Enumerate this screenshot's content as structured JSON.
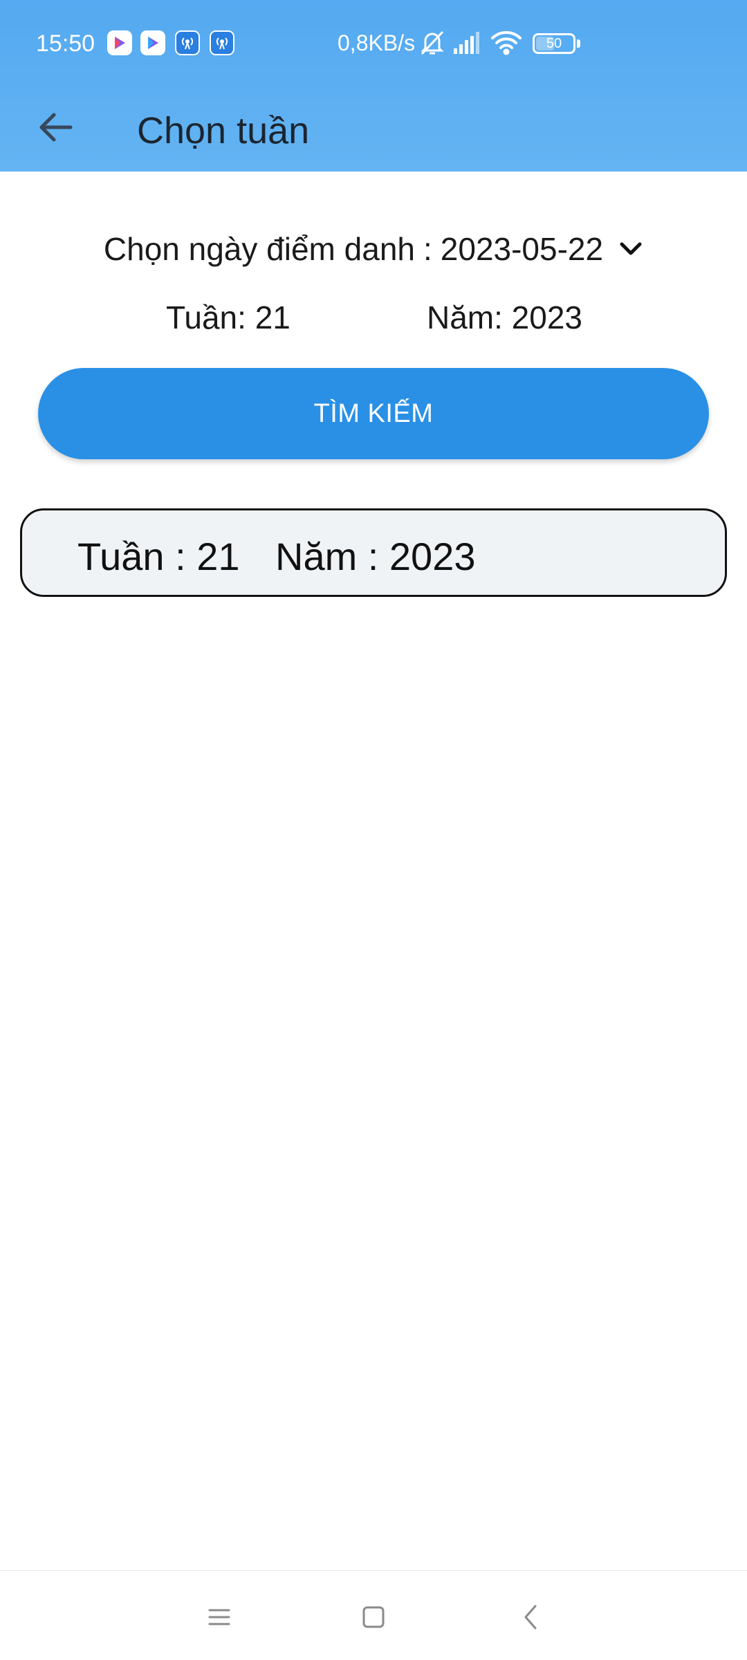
{
  "status_bar": {
    "time": "15:50",
    "network_speed": "0,8KB/s",
    "battery_level": "50",
    "battery_fraction": 0.5,
    "icons": [
      "play-store-icon",
      "play-store-icon",
      "radio-app-icon",
      "radio-app-icon",
      "bell-muted-icon",
      "signal-icon",
      "wifi-icon",
      "battery-icon"
    ]
  },
  "toolbar": {
    "title": "Chọn tuần",
    "back_icon": "arrow-left-icon"
  },
  "date_picker": {
    "label": "Chọn ngày điểm danh",
    "separator": ":",
    "value": "2023-05-22",
    "dropdown_icon": "chevron-down-icon"
  },
  "week_info": {
    "week_text": "Tuần: 21",
    "year_text": "Năm: 2023"
  },
  "search_button": {
    "label": "TÌM KIẾM"
  },
  "result": {
    "week_text": "Tuần : 21",
    "year_text": "Năm : 2023"
  },
  "colors": {
    "header": "#5aaef2",
    "primary_button": "#2a90e6",
    "card_background": "#eff3f6"
  },
  "nav_bar": {
    "icons": [
      "menu-icon",
      "home-icon",
      "back-icon"
    ]
  }
}
